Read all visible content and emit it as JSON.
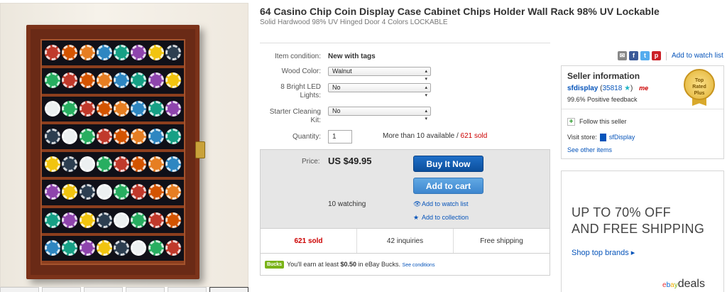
{
  "listing": {
    "title": "64 Casino Chip Coin Display Case Cabinet Chips Holder Wall Rack 98% UV Lockable",
    "subtitle": "Solid Hardwood 98% UV Hinged Door 4 Colors LOCKABLE"
  },
  "form": {
    "condition_label": "Item condition:",
    "condition_value": "New with tags",
    "wood_label": "Wood Color:",
    "wood_value": "Walnut",
    "led_label": "8 Bright LED Lights:",
    "led_value": "No",
    "kit_label": "Starter Cleaning Kit:",
    "kit_value": "No",
    "qty_label": "Quantity:",
    "qty_value": "1",
    "avail_text": "More than 10 available / ",
    "avail_sold": "621 sold"
  },
  "purchase": {
    "price_label": "Price:",
    "price": "US $49.95",
    "buy_now": "Buy It Now",
    "add_to_cart": "Add to cart",
    "watching": "10 watching",
    "watch_link": "Add to watch list",
    "collection_link": "Add to collection"
  },
  "stats": {
    "sold": "621 sold",
    "inquiries": "42 inquiries",
    "shipping": "Free shipping"
  },
  "bucks": {
    "badge": "Bucks",
    "prefix": "You'll earn at least ",
    "amount": "$0.50",
    "suffix": " in eBay Bucks.",
    "see": "See conditions"
  },
  "share": {
    "watch_link": "Add to watch list"
  },
  "seller": {
    "heading": "Seller information",
    "name": "sfdisplay",
    "feedback_count": "35818",
    "me_badge": "me",
    "positive": "99.6% Positive feedback",
    "badge_top": "Top",
    "badge_mid": "Rated",
    "badge_bot": "Plus",
    "follow": "Follow this seller",
    "visit_label": "Visit store:",
    "store_name": "sfDisplay",
    "see_other": "See other items"
  },
  "ad": {
    "line1": "UP TO 70% OFF",
    "line2": "AND FREE SHIPPING",
    "cta": "Shop top brands ▸",
    "brand": "ebay",
    "brand_suffix": "deals"
  },
  "colors": {
    "link": "#0654ba",
    "buy_button": "#0c4f9c",
    "cart_button": "#3d86cf",
    "sold_red": "#cc0000"
  }
}
